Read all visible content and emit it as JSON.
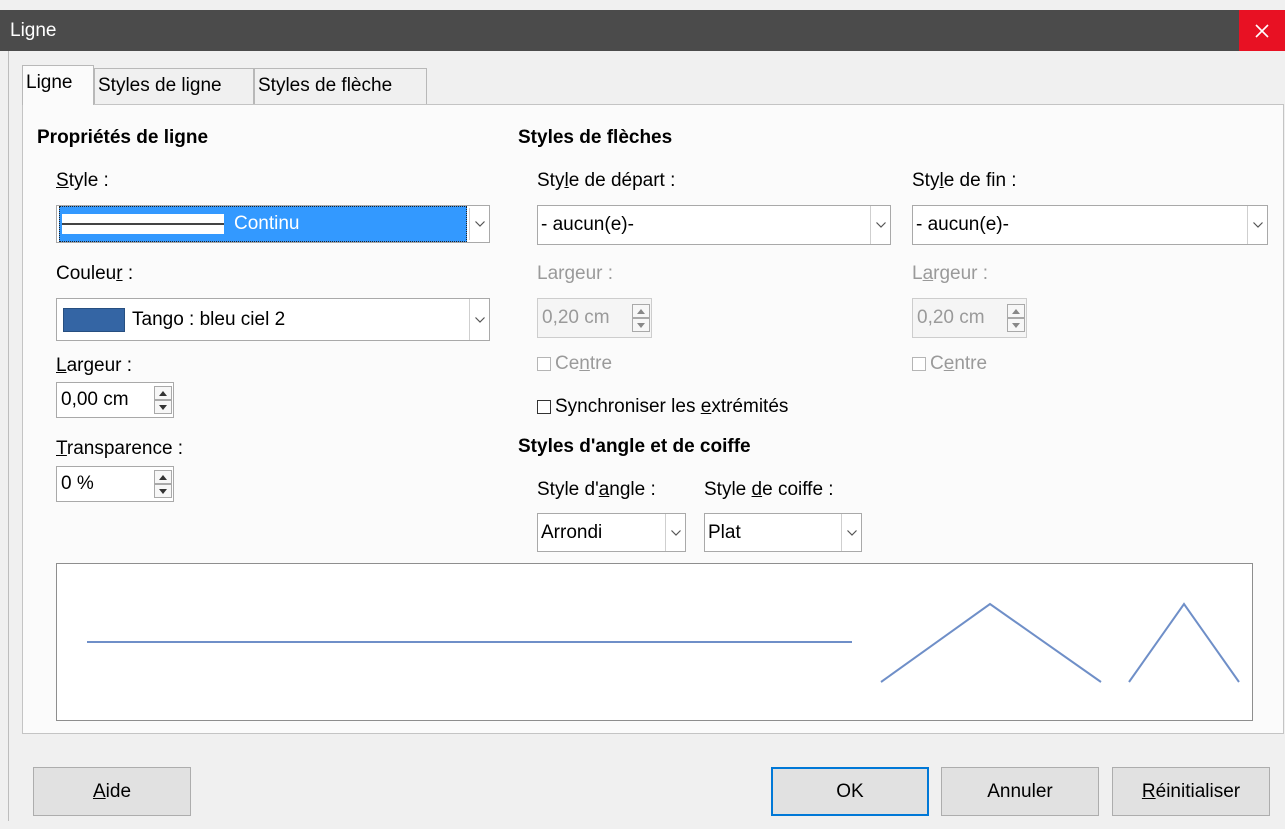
{
  "window": {
    "title": "Ligne"
  },
  "tabs": [
    {
      "label": "Ligne"
    },
    {
      "label": "Styles de ligne"
    },
    {
      "label": "Styles de flèche"
    }
  ],
  "line_props": {
    "heading": "Propriétés de ligne",
    "style": {
      "label_u": "S",
      "label_rest": "tyle :",
      "value": "Continu"
    },
    "color": {
      "label_pre": "Couleu",
      "label_u": "r",
      "label_post": " :",
      "value": "Tango : bleu ciel 2",
      "swatch": "#3465a4"
    },
    "width": {
      "label_u": "L",
      "label_rest": "argeur :",
      "value": "0,00 cm"
    },
    "transparency": {
      "label_u": "T",
      "label_rest": "ransparence :",
      "value": "0 %"
    }
  },
  "arrow_styles": {
    "heading": "Styles de flèches",
    "start": {
      "label_pre": "Sty",
      "label_u": "l",
      "label_post": "e de départ :",
      "value": "- aucun(e)-",
      "width_label_pre": "Lar",
      "width_label_u": "g",
      "width_label_post": "eur :",
      "width_value": "0,20 cm",
      "center_pre": "Ce",
      "center_u": "n",
      "center_post": "tre"
    },
    "end": {
      "label_pre": "Sty",
      "label_u": "l",
      "label_post": "e de fin :",
      "value": "- aucun(e)-",
      "width_label_pre": "L",
      "width_label_u": "a",
      "width_label_post": "rgeur :",
      "width_value": "0,20 cm",
      "center_pre": "C",
      "center_u": "e",
      "center_post": "ntre"
    },
    "sync_pre": "Synchroniser les ",
    "sync_u": "e",
    "sync_post": "xtrémités"
  },
  "corner_cap": {
    "heading": "Styles d'angle et de coiffe",
    "corner": {
      "label_pre": "Style d'",
      "label_u": "a",
      "label_post": "ngle :",
      "value": "Arrondi"
    },
    "cap": {
      "label_pre": "Style ",
      "label_u": "d",
      "label_post": "e coiffe :",
      "value": "Plat"
    }
  },
  "preview": {
    "line_color": "#6f8fc8"
  },
  "buttons": {
    "help_u": "A",
    "help_rest": "ide",
    "ok": "OK",
    "cancel": "Annuler",
    "reset_u": "R",
    "reset_rest": "éinitialiser"
  },
  "colors": {
    "selected": "#3399ff",
    "close": "#e81123",
    "title_bar": "#4b4b4b"
  }
}
